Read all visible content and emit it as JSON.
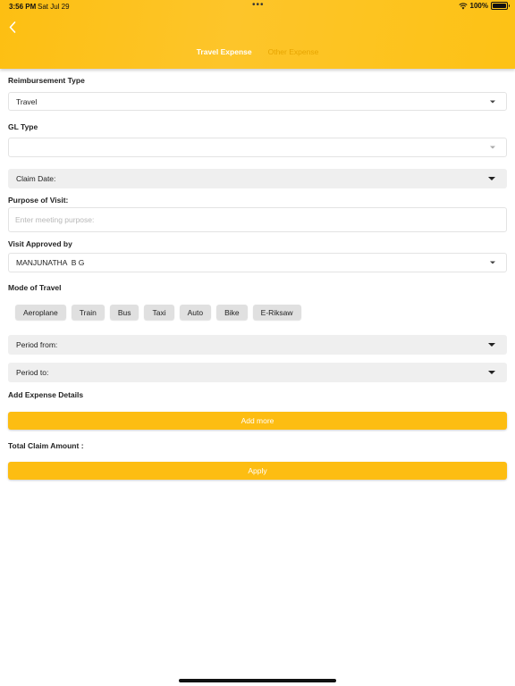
{
  "status_bar": {
    "time": "3:56 PM",
    "date": "Sat Jul 29",
    "dots": "•••",
    "battery": "100%"
  },
  "header": {
    "back_icon": "chevron-left-icon",
    "tabs": [
      {
        "label": "Travel Expense",
        "active": true
      },
      {
        "label": "Other Expense",
        "active": false
      }
    ]
  },
  "form": {
    "reimbursement_type": {
      "label": "Reimbursement Type",
      "value": "Travel"
    },
    "gl_type": {
      "label": "GL Type",
      "value": ""
    },
    "claim_date": {
      "placeholder": "Claim Date:"
    },
    "purpose": {
      "label": "Purpose of Visit:",
      "placeholder": "Enter meeting purpose:"
    },
    "approved_by": {
      "label": "Visit Approved by",
      "value": "MANJUNATHA  B G"
    },
    "mode_of_travel": {
      "label": "Mode of Travel",
      "options": [
        "Aeroplane",
        "Train",
        "Bus",
        "Taxi",
        "Auto",
        "Bike",
        "E-Riksaw"
      ]
    },
    "period_from": {
      "placeholder": "Period from:"
    },
    "period_to": {
      "placeholder": "Period to:"
    },
    "expense_details": {
      "label": "Add Expense Details",
      "button": "Add more"
    },
    "total_claim": {
      "label": "Total Claim Amount :"
    },
    "apply_button": "Apply"
  },
  "colors": {
    "accent": "#fdbd12",
    "tab_inactive": "#e6a400",
    "chip_bg": "#e0e0e0"
  }
}
